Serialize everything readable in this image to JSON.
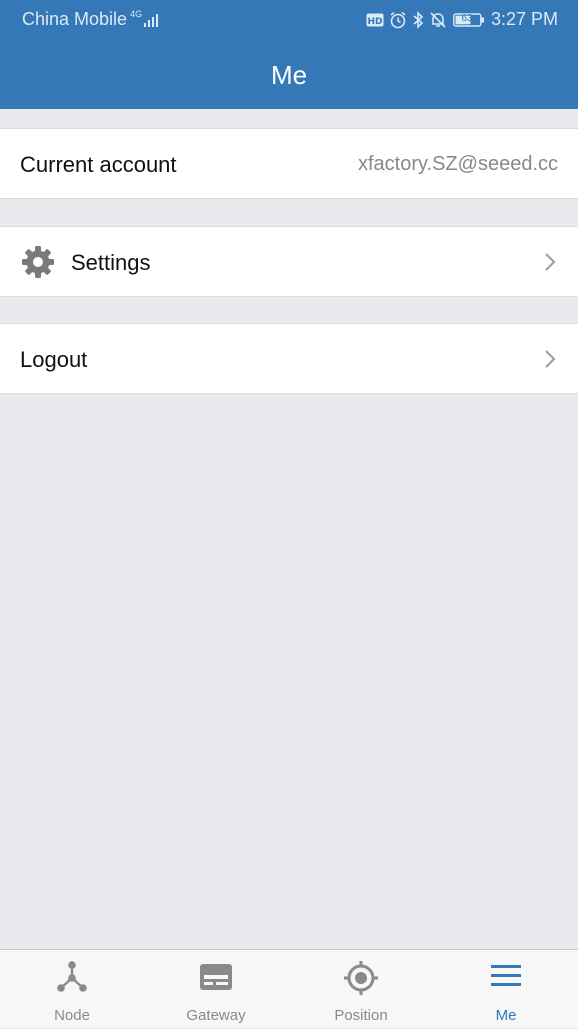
{
  "status_bar": {
    "carrier": "China Mobile",
    "network": "4G",
    "battery": "63",
    "time": "3:27 PM"
  },
  "header": {
    "title": "Me"
  },
  "account_row": {
    "label": "Current account",
    "value": "xfactory.SZ@seeed.cc"
  },
  "settings_row": {
    "label": "Settings",
    "icon": "gear-icon"
  },
  "logout_row": {
    "label": "Logout"
  },
  "tab_bar": {
    "items": [
      {
        "label": "Node",
        "icon": "node-icon"
      },
      {
        "label": "Gateway",
        "icon": "gateway-icon"
      },
      {
        "label": "Position",
        "icon": "position-icon"
      },
      {
        "label": "Me",
        "icon": "menu-icon"
      }
    ],
    "active": "Me"
  },
  "colors": {
    "primary": "#3478b7",
    "background": "#e9e9ee",
    "inactive_tab": "#8a8a8a"
  }
}
